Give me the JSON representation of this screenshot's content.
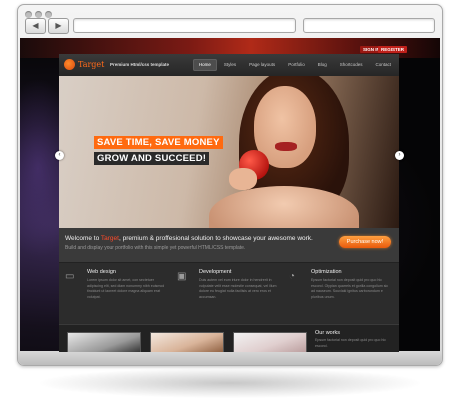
{
  "browser": {
    "back_glyph": "◀",
    "forward_glyph": "▶",
    "url_value": "",
    "search_value": ""
  },
  "topbar": {
    "sign_in": "SIGN IN",
    "register": "REGISTER"
  },
  "site": {
    "logo": "Target",
    "tagline": "Premium Html/css template",
    "menu": [
      "Home",
      "Styles",
      "Page layouts",
      "Portfolio",
      "Blog",
      "Shortcodes",
      "Contact"
    ],
    "active_menu_index": 0
  },
  "hero": {
    "headline1": "SAVE TIME, SAVE MONEY",
    "headline2": "GROW AND SUCCEED!",
    "prev_glyph": "‹",
    "next_glyph": "›"
  },
  "welcome": {
    "prefix": "Welcome to ",
    "brand": "Target",
    "suffix": ", premium & proffesional solution to showcase your awesome work.",
    "sub": "Build and display your portfolio with this simple yet powerful HTML/CSS template.",
    "button": "Purchase now!"
  },
  "features": [
    {
      "icon": "monitor-icon",
      "glyph": "▭",
      "title": "Web design",
      "text": "Lorem ipsum dolor sit amet, con sectetuer adipiscing elit, sed diam nonummy nibh euismod tincidunt ut laoreet dolore magna aliquam erat volutpat."
    },
    {
      "icon": "code-icon",
      "glyph": "▣",
      "title": "Development",
      "text": "Duis autem vel eum iriure dolor in hendrerit in vulputate velit esse molestie consequat, vel illum dolore eu feugiat nulla facilisis at vero eros et accumsan."
    },
    {
      "icon": "gauge-icon",
      "glyph": "◔",
      "title": "Optimization",
      "text": "Epsum factorial non deposit quid pro quo hic escorol. Olypian quarrels et gorilla congolium sic ad nauseum. Souvlaki ignitus carborundum e pluribus unum."
    }
  ],
  "works": {
    "title": "Our works",
    "text": "Epsum factorial non deposit quid pro quo hic escorol."
  },
  "colors": {
    "accent": "#ff6a10",
    "brand_red": "#ff4a2a",
    "dark": "#2b2b2b"
  }
}
